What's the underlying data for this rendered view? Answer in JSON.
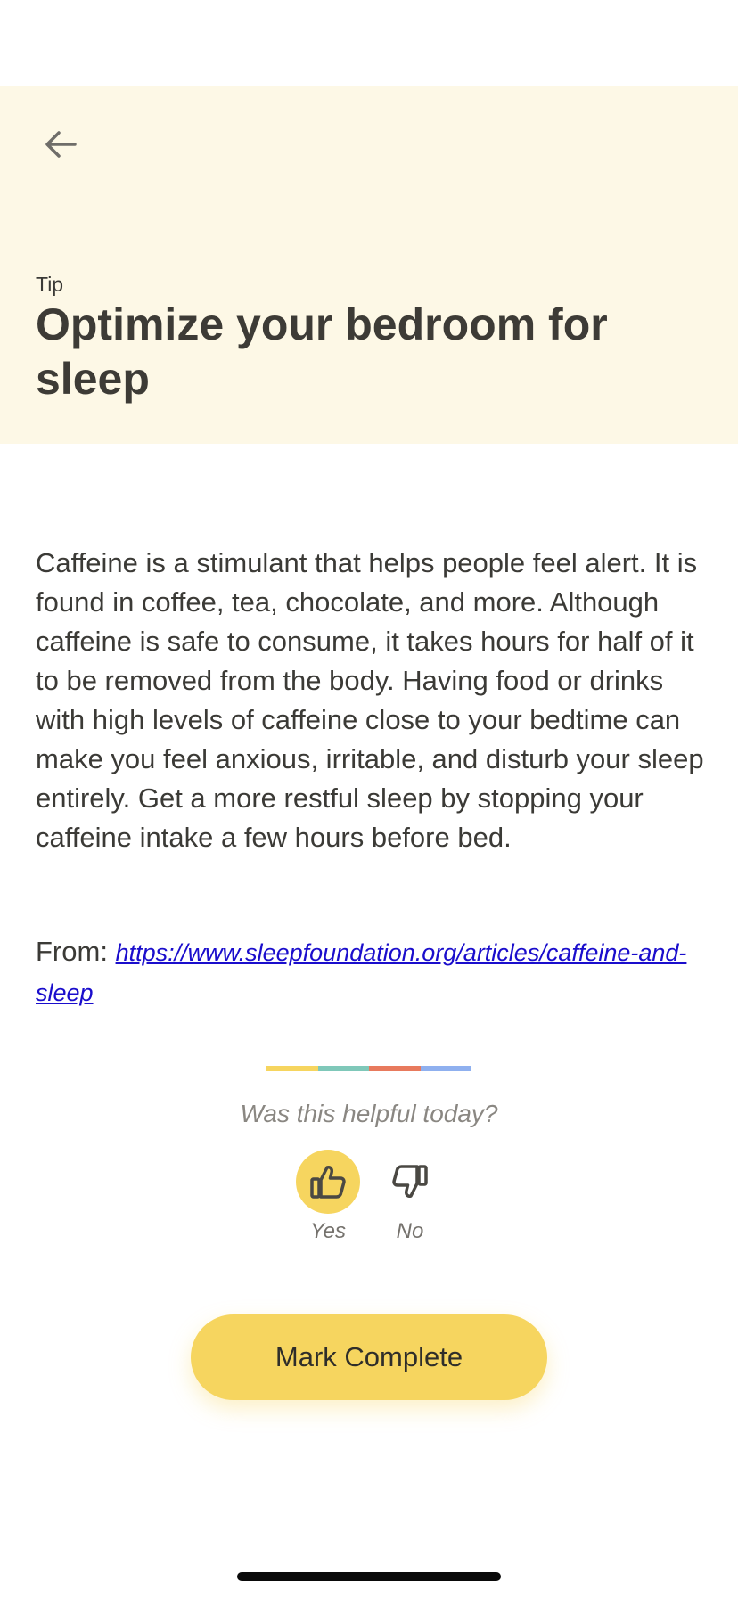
{
  "header": {
    "back_icon": "arrow-left-icon",
    "label": "Tip",
    "title": "Optimize your bedroom for sleep"
  },
  "article": {
    "body": "Caffeine is a stimulant that helps people feel alert. It is found in coffee, tea, chocolate, and more. Although caffeine is safe to consume, it takes hours for half of it to be removed from the body. Having food or drinks with high levels of caffeine close to your bedtime can make you feel anxious, irritable, and disturb your sleep entirely. Get a more restful sleep by stopping your caffeine intake a few hours before bed.",
    "source_prefix": "From:",
    "source_url": "https://www.sleepfoundation.org/articles/caffeine-and-sleep"
  },
  "divider_colors": [
    "#f6d55f",
    "#7fc8b9",
    "#e87a5d",
    "#8fb0ef"
  ],
  "feedback": {
    "question": "Was this helpful today?",
    "yes_label": "Yes",
    "yes_icon": "thumbs-up-icon",
    "yes_selected": true,
    "no_label": "No",
    "no_icon": "thumbs-down-icon"
  },
  "actions": {
    "mark_complete_label": "Mark Complete"
  },
  "colors": {
    "hero_background": "#fdf8e6",
    "accent_yellow": "#f6d55f",
    "link": "#1a0dcc"
  }
}
